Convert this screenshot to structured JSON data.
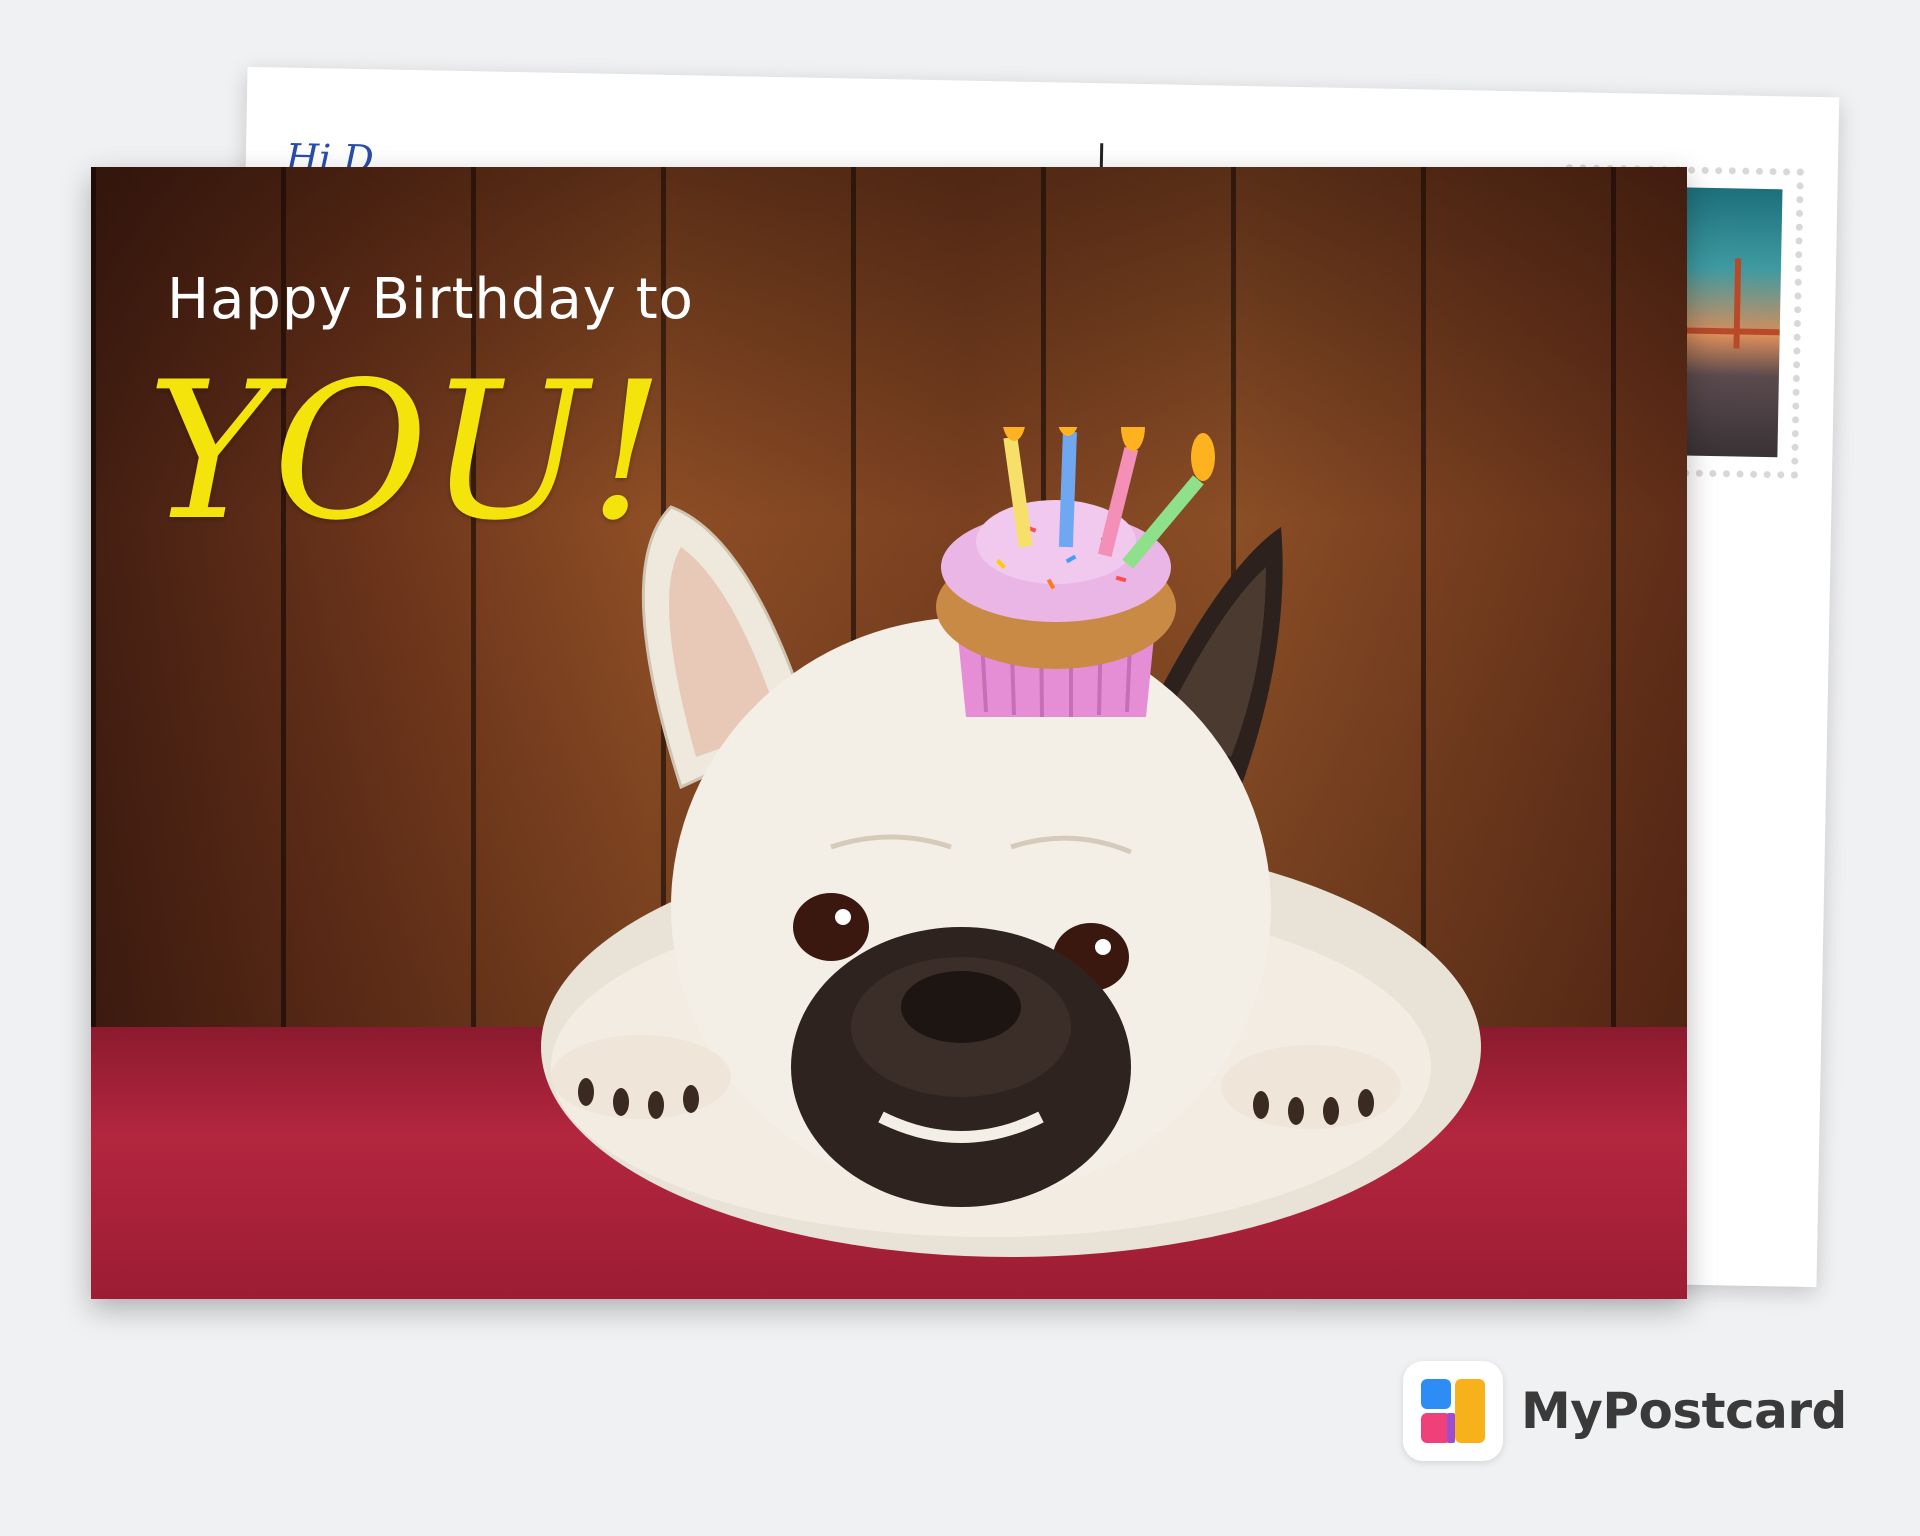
{
  "postcard": {
    "front": {
      "greeting_line": "Happy Birthday to",
      "greeting_big": "YOU!"
    },
    "back": {
      "greeting_partial": "Hi D..."
    }
  },
  "brand": {
    "logo_text": "MyPostcard",
    "logo_colors": {
      "blue": "#2e8df5",
      "pink": "#f0407a",
      "yellow": "#f7b21b",
      "purple": "#9b4fd0"
    }
  },
  "colors": {
    "greeting_yellow": "#f4e40c",
    "cushion_red": "#b3263e",
    "wood_brown": "#8a4a25"
  }
}
